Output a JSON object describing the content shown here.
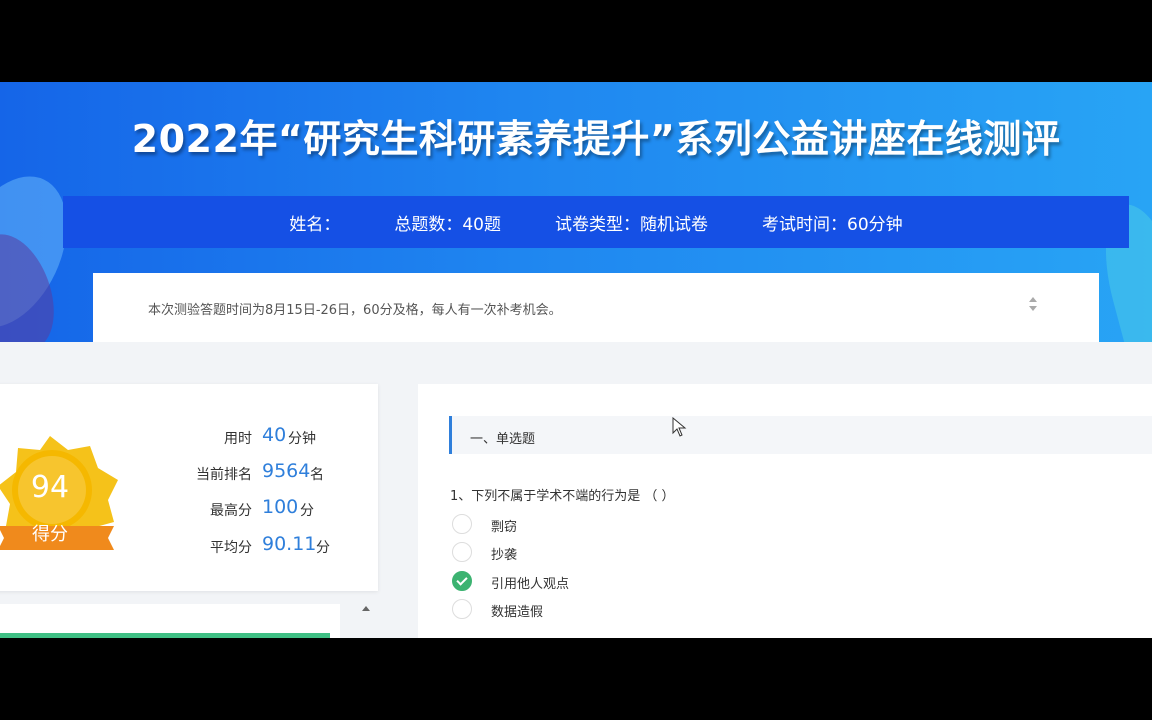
{
  "header": {
    "title": "2022年“研究生科研素养提升”系列公益讲座在线测评"
  },
  "exam_info": {
    "name": "姓名：",
    "total_questions": "总题数：40题",
    "paper_type": "试卷类型：随机试卷",
    "exam_time": "考试时间：60分钟"
  },
  "notice": "本次测验答题时间为8月15日-26日，60分及格，每人有一次补考机会。",
  "score_card": {
    "score": "94",
    "score_label": "得分",
    "stats": [
      {
        "label": "用时",
        "value": "40",
        "unit": "分钟"
      },
      {
        "label": "当前排名",
        "value": "9564",
        "unit": "名"
      },
      {
        "label": "最高分",
        "value": "100",
        "unit": "分"
      },
      {
        "label": "平均分",
        "value": "90.11",
        "unit": "分"
      }
    ]
  },
  "question_panel": {
    "section_title": "一、单选题",
    "question": "1、下列不属于学术不端的行为是 （ ）",
    "options": [
      {
        "label": "剽窃",
        "selected": false
      },
      {
        "label": "抄袭",
        "selected": false
      },
      {
        "label": "引用他人观点",
        "selected": true
      },
      {
        "label": "数据造假",
        "selected": false
      }
    ]
  },
  "colors": {
    "banner_blue": "#1f86f0",
    "info_bar": "#1550e5",
    "accent_blue": "#2f7fdb",
    "badge_gold": "#f5b800",
    "ribbon_orange": "#f08a1c",
    "selected_green": "#3cb371"
  }
}
